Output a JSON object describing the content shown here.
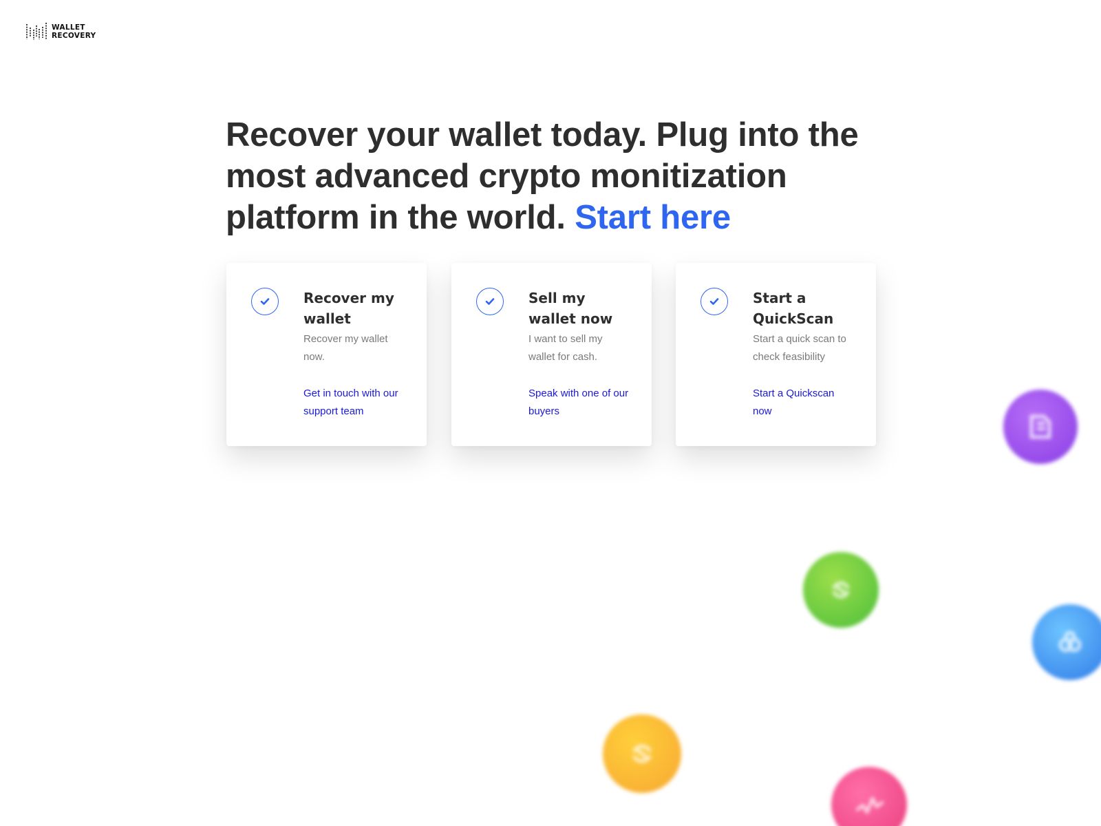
{
  "brand": {
    "line1": "WALLET",
    "line2": "RECOVERY"
  },
  "hero": {
    "headline": "Recover your wallet today. Plug into the most advanced crypto monitization platform in the world.",
    "cta": "Start here"
  },
  "cards": [
    {
      "title": "Recover my wallet",
      "desc": "Recover my wallet now.",
      "link": "Get in touch with our support team"
    },
    {
      "title": "Sell my wallet now",
      "desc": "I want to sell my wallet for cash.",
      "link": "Speak with one of our buyers"
    },
    {
      "title": "Start a QuickScan",
      "desc": "Start a quick scan to check feasibility",
      "link": "Start a Quickscan now"
    }
  ],
  "colors": {
    "accent": "#2f66f0",
    "link": "#1a1ad6",
    "text": "#2e2e2e",
    "muted": "#7a7a7a"
  },
  "decor": {
    "bubbles": [
      "purple-coin-icon",
      "green-coin-icon",
      "blue-coin-icon",
      "orange-coin-icon",
      "pink-coin-icon"
    ]
  }
}
